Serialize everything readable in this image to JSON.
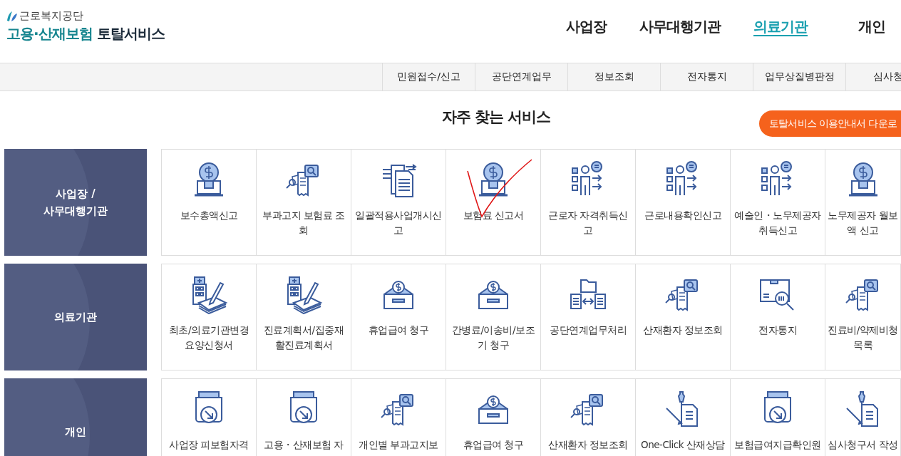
{
  "logo": {
    "org": "근로복지공단",
    "title_highlight": "고용·산재보험",
    "title_rest": "토탈서비스"
  },
  "main_nav": [
    {
      "label": "사업장",
      "selected": false
    },
    {
      "label": "사무대행기관",
      "selected": false
    },
    {
      "label": "의료기관",
      "selected": true
    },
    {
      "label": "개인",
      "selected": false
    }
  ],
  "sub_nav": [
    "민원접수/신고",
    "공단연계업무",
    "정보조회",
    "전자통지",
    "업무상질병판정",
    "심사청"
  ],
  "section_title": "자주 찾는 서비스",
  "guide_button": "토탈서비스 이용안내서 다운로",
  "groups": [
    {
      "lines": [
        "사업장 /",
        "사무대행기관"
      ],
      "services": [
        {
          "kind": "money-bulb",
          "lines": [
            "보수총액신고"
          ]
        },
        {
          "kind": "search-doc",
          "lines": [
            "부과고지 보험료 조",
            "회"
          ]
        },
        {
          "kind": "doc-arrows",
          "lines": [
            "일괄적용사업개시신",
            "고"
          ]
        },
        {
          "kind": "money-bulb",
          "lines": [
            "보험료 신고서"
          ]
        },
        {
          "kind": "people-list",
          "lines": [
            "근로자 자격취득신",
            "고"
          ]
        },
        {
          "kind": "people-list",
          "lines": [
            "근로내용확인신고"
          ]
        },
        {
          "kind": "people-list",
          "lines": [
            "예술인・노무제공자",
            "취득신고"
          ]
        },
        {
          "kind": "money-bulb",
          "lines": [
            "노무제공자 월보",
            "액 신고"
          ]
        }
      ]
    },
    {
      "lines": [
        "의료기관"
      ],
      "services": [
        {
          "kind": "hospital-pen",
          "lines": [
            "최초/의료기관변경",
            "요양신청서"
          ]
        },
        {
          "kind": "hospital-pen",
          "lines": [
            "진료계획서/집중재",
            "활진료계획서"
          ]
        },
        {
          "kind": "money-box",
          "lines": [
            "휴업급여 청구"
          ]
        },
        {
          "kind": "money-box",
          "lines": [
            "간병료/이송비/보조",
            "기 청구"
          ]
        },
        {
          "kind": "folder-exchange",
          "lines": [
            "공단연계업무처리"
          ]
        },
        {
          "kind": "search-doc",
          "lines": [
            "산재환자 정보조회"
          ]
        },
        {
          "kind": "box-search",
          "lines": [
            "전자통지"
          ]
        },
        {
          "kind": "search-doc",
          "lines": [
            "진료비/약제비청",
            "목록"
          ]
        }
      ]
    },
    {
      "lines": [
        "개인"
      ],
      "services": [
        {
          "kind": "tray-arrow",
          "lines": [
            "사업장 피보험자격"
          ]
        },
        {
          "kind": "tray-arrow",
          "lines": [
            "고용・산재보험 자"
          ]
        },
        {
          "kind": "search-doc",
          "lines": [
            "개인별 부과고지보"
          ]
        },
        {
          "kind": "money-box",
          "lines": [
            "휴업급여 청구"
          ]
        },
        {
          "kind": "search-doc",
          "lines": [
            "산재환자 정보조회"
          ]
        },
        {
          "kind": "pin-doc",
          "lines": [
            "One-Click 산재상담"
          ]
        },
        {
          "kind": "tray-arrow",
          "lines": [
            "보험급여지급확인원"
          ]
        },
        {
          "kind": "pin-doc",
          "lines": [
            "심사청구서 작성"
          ]
        }
      ]
    }
  ]
}
